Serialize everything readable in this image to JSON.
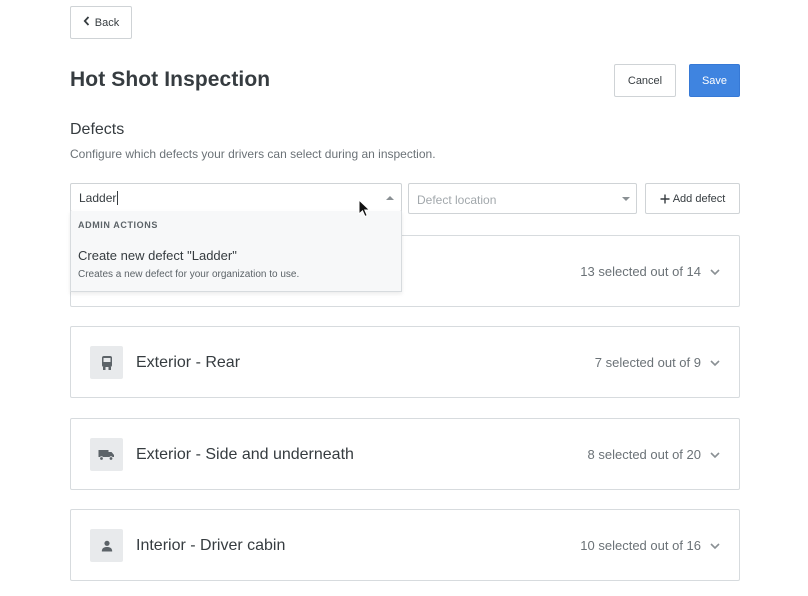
{
  "nav": {
    "back_label": "Back"
  },
  "header": {
    "title": "Hot Shot Inspection",
    "cancel_label": "Cancel",
    "save_label": "Save"
  },
  "defects": {
    "heading": "Defects",
    "description": "Configure which defects your drivers can select during an inspection."
  },
  "search": {
    "value": "Ladder"
  },
  "location": {
    "placeholder": "Defect location"
  },
  "add_defect_label": "Add defect",
  "dropdown": {
    "group_label": "ADMIN ACTIONS",
    "option_title": "Create new defect \"Ladder\"",
    "option_subtitle": "Creates a new defect for your organization to use."
  },
  "cards": [
    {
      "title": "",
      "count": "13 selected out of 14",
      "icon": "hidden"
    },
    {
      "title": "Exterior - Rear",
      "count": "7 selected out of 9",
      "icon": "bus-rear-icon"
    },
    {
      "title": "Exterior - Side and underneath",
      "count": "8 selected out of 20",
      "icon": "truck-icon"
    },
    {
      "title": "Interior - Driver cabin",
      "count": "10 selected out of 16",
      "icon": "person-icon"
    }
  ],
  "colors": {
    "primary": "#3f84e0",
    "border": "#cfd3d6",
    "text": "#363c40",
    "muted": "#6b7277"
  }
}
